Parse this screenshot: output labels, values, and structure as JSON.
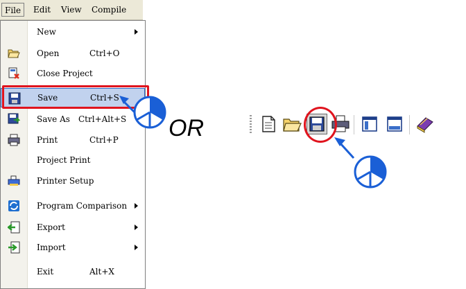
{
  "menubar": {
    "items": [
      {
        "label": "File",
        "underline": "F"
      },
      {
        "label": "Edit",
        "underline": "E"
      },
      {
        "label": "View",
        "underline": "V"
      },
      {
        "label": "Compile",
        "underline": "C"
      }
    ]
  },
  "file_menu": {
    "items": [
      {
        "label": "New",
        "shortcut": "",
        "submenu": true,
        "icon": "none"
      },
      {
        "label": "Open",
        "shortcut": "Ctrl+O",
        "submenu": false,
        "icon": "open-folder-icon"
      },
      {
        "label": "Close Project",
        "shortcut": "",
        "submenu": false,
        "icon": "close-project-icon"
      },
      {
        "label": "Save",
        "shortcut": "Ctrl+S",
        "submenu": false,
        "icon": "save-disk-icon",
        "highlighted": true
      },
      {
        "label": "Save As",
        "shortcut": "Ctrl+Alt+S",
        "submenu": false,
        "icon": "save-as-icon"
      },
      {
        "label": "Print",
        "shortcut": "Ctrl+P",
        "submenu": false,
        "icon": "printer-icon"
      },
      {
        "label": "Project Print",
        "shortcut": "",
        "submenu": false,
        "icon": "none"
      },
      {
        "label": "Printer Setup",
        "shortcut": "",
        "submenu": false,
        "icon": "printer-setup-icon"
      },
      {
        "label": "Program Comparison",
        "shortcut": "",
        "submenu": true,
        "icon": "comparison-icon"
      },
      {
        "label": "Export",
        "shortcut": "",
        "submenu": true,
        "icon": "export-icon"
      },
      {
        "label": "Import",
        "shortcut": "",
        "submenu": true,
        "icon": "import-icon"
      },
      {
        "label": "Exit",
        "shortcut": "Alt+X",
        "submenu": false,
        "icon": "none"
      }
    ]
  },
  "or_label": "OR",
  "toolbar": {
    "buttons": [
      {
        "icon": "new-document-icon"
      },
      {
        "icon": "open-folder-icon"
      },
      {
        "icon": "save-disk-icon",
        "pressed": true
      },
      {
        "icon": "printer-icon"
      },
      {
        "icon": "panel-left-icon"
      },
      {
        "icon": "panel-bottom-icon"
      },
      {
        "icon": "book-icon"
      }
    ]
  },
  "colors": {
    "highlight_red": "#e0141e",
    "pointer_blue": "#1a5fd6",
    "menu_hover": "#c1d2ee"
  }
}
